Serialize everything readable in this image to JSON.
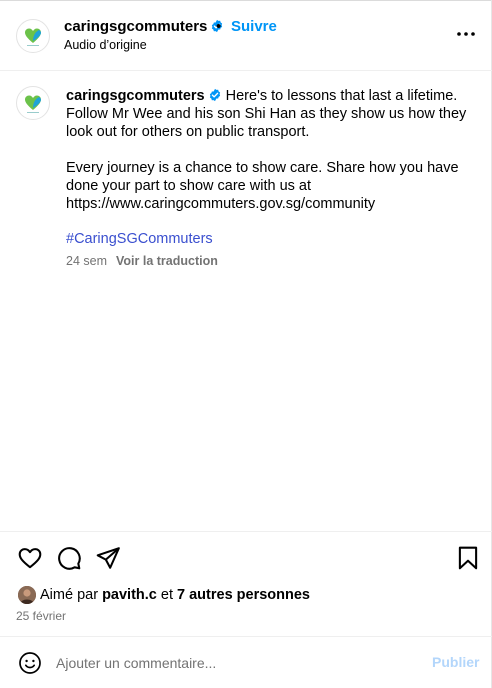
{
  "header": {
    "username": "caringsgcommuters",
    "separator": "•",
    "follow_label": "Suivre",
    "audio": "Audio d’origine"
  },
  "caption": {
    "username": "caringsgcommuters",
    "text1": "Here's to lessons that last a lifetime. Follow Mr Wee and his son Shi Han as they show us how they look out for others on public transport.",
    "text2": "Every journey is a chance to show care. Share how you have done your part to show care with us at https://www.caringcommuters.gov.sg/community",
    "hashtag": "#CaringSGCommuters",
    "age": "24 sem",
    "translate_label": "Voir la traduction"
  },
  "likes": {
    "prefix": "Aimé par",
    "user": "pavith.c",
    "connector": "et",
    "others": "7 autres personnes"
  },
  "date": "25 février",
  "comment": {
    "placeholder": "Ajouter un commentaire...",
    "publish_label": "Publier"
  },
  "colors": {
    "link_blue": "#0095f6",
    "hashtag": "#3a4fcf",
    "verified": "#0095f6",
    "publish_disabled": "#b3d6fb"
  },
  "icons": [
    "more-options-icon",
    "heart-icon",
    "comment-icon",
    "share-icon",
    "bookmark-icon",
    "emoji-icon",
    "verified-icon"
  ]
}
